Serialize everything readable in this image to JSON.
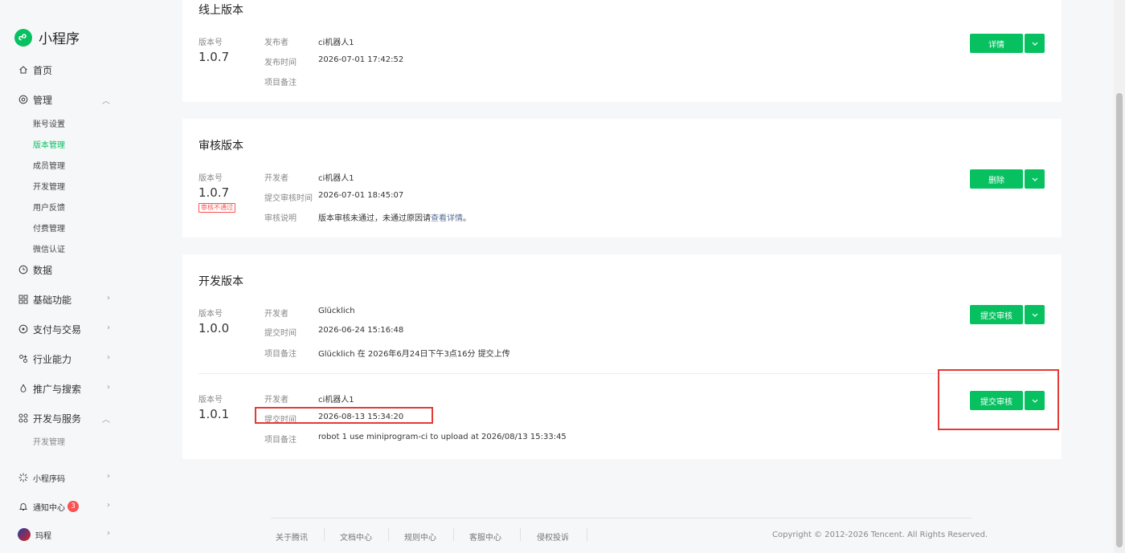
{
  "app": {
    "name": "小程序"
  },
  "nav": {
    "home": "首页",
    "manage": "管理",
    "manage_sub": [
      "账号设置",
      "版本管理",
      "成员管理",
      "开发管理",
      "用户反馈",
      "付费管理",
      "微信认证"
    ],
    "data": "数据",
    "basic": "基础功能",
    "pay": "支付与交易",
    "industry": "行业能力",
    "promo": "推广与搜索",
    "dev": "开发与服务",
    "dev_sub": [
      "开发管理"
    ],
    "qrcode": "小程序码",
    "notify": "通知中心",
    "notify_count": "3",
    "user": "玛程"
  },
  "online": {
    "title": "线上版本",
    "version_label": "版本号",
    "version": "1.0.7",
    "publisher_label": "发布者",
    "publisher": "ci机器人1",
    "time_label": "发布时间",
    "time": "2026-07-01 17:42:52",
    "note_label": "项目备注",
    "button": "详情"
  },
  "review": {
    "title": "审核版本",
    "version_label": "版本号",
    "version": "1.0.7",
    "status": "审核不通过",
    "dev_label": "开发者",
    "dev": "ci机器人1",
    "time_label": "提交审核时间",
    "time": "2026-07-01 18:45:07",
    "desc_label": "审核说明",
    "desc_prefix": "版本审核未通过，未通过原因请",
    "desc_link": "查看详情",
    "desc_suffix": "。",
    "button": "删除"
  },
  "dev": {
    "title": "开发版本",
    "items": [
      {
        "version_label": "版本号",
        "version": "1.0.0",
        "dev_label": "开发者",
        "dev": "Glücklich",
        "time_label": "提交时间",
        "time": "2026-06-24 15:16:48",
        "note_label": "项目备注",
        "note": "Glücklich 在 2026年6月24日下午3点16分 提交上传",
        "button": "提交审核"
      },
      {
        "version_label": "版本号",
        "version": "1.0.1",
        "dev_label": "开发者",
        "dev": "ci机器人1",
        "time_label": "提交时间",
        "time": "2026-08-13 15:34:20",
        "note_label": "项目备注",
        "note": "robot 1 use miniprogram-ci to upload at 2026/08/13 15:33:45",
        "button": "提交审核"
      }
    ]
  },
  "footer": {
    "links": [
      "关于腾讯",
      "文档中心",
      "规则中心",
      "客服中心",
      "侵权投诉"
    ],
    "copyright": "Copyright © 2012-2026 Tencent. All Rights Reserved."
  },
  "colors": {
    "accent": "#07c160",
    "danger": "#fa5151",
    "link": "#576b95",
    "highlight": "#e53935"
  }
}
